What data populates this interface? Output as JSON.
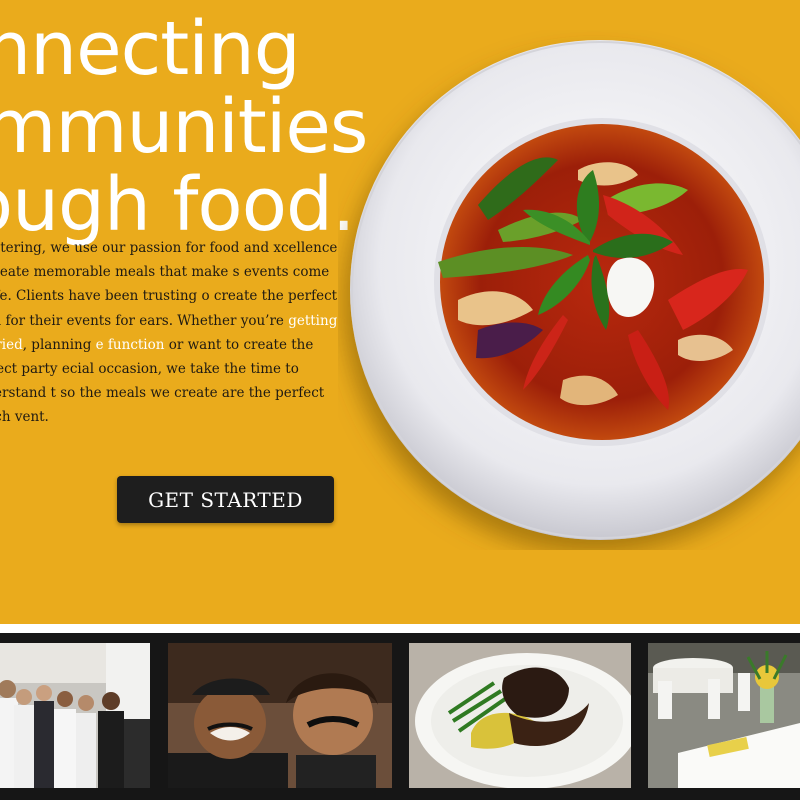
{
  "hero": {
    "headline": [
      "onnecting",
      "ommunities",
      "rough food."
    ],
    "paragraph": {
      "part1": "ff Catering, we use our passion for food and xcellence to create memorable meals that make s events come to life. Clients have been trusting o create the perfect meal for their events for ears. Whether you’re ",
      "link1": "getting married",
      "part2": ", planning ",
      "link2": "e function",
      "part3": " or want to create the perfect party ecial occasion, we take the time to understand t so the meals we create are the perfect match vent."
    },
    "cta_label": "GET STARTED"
  },
  "colors": {
    "brand_yellow": "#eaab1c",
    "cta_background": "#1e1e1e",
    "link_color": "#ffffff",
    "strip_background": "#161616"
  },
  "gallery": {
    "items": [
      {
        "icon": "catering-staff-photo"
      },
      {
        "icon": "chef-and-girl-mustache-photo"
      },
      {
        "icon": "short-rib-plate-photo"
      },
      {
        "icon": "banquet-tables-photo"
      }
    ]
  }
}
